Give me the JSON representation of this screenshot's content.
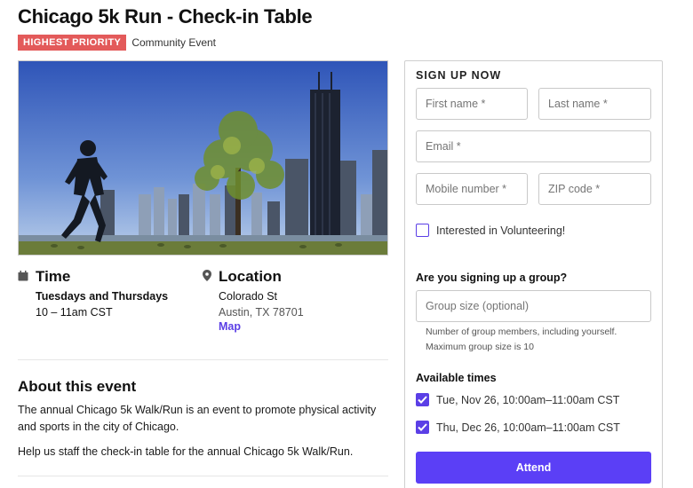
{
  "event": {
    "title": "Chicago 5k Run - Check-in Table",
    "priority_badge": "HIGHEST PRIORITY",
    "event_type": "Community Event"
  },
  "time": {
    "heading": "Time",
    "days": "Tuesdays and Thursdays",
    "hours": "10 – 11am CST"
  },
  "location": {
    "heading": "Location",
    "street": "Colorado St",
    "city": "Austin, TX 78701",
    "map_link": "Map"
  },
  "about": {
    "heading": "About this event",
    "paragraph1": "The annual Chicago 5k Walk/Run is an event to promote physical activity and sports in the city of Chicago.",
    "paragraph2": "Help us staff the check-in table for the annual Chicago 5k Walk/Run."
  },
  "signup": {
    "heading": "SIGN UP NOW",
    "first_name_placeholder": "First name *",
    "last_name_placeholder": "Last name *",
    "email_placeholder": "Email *",
    "mobile_placeholder": "Mobile number *",
    "zip_placeholder": "ZIP code *",
    "volunteer_label": "Interested in Volunteering!",
    "volunteer_checked": false,
    "group_question": "Are you signing up a group?",
    "group_size_placeholder": "Group size (optional)",
    "group_help_1": "Number of group members, including yourself.",
    "group_help_2": "Maximum group size is 10",
    "times_heading": "Available times",
    "times": [
      {
        "label": "Tue, Nov 26, 10:00am–11:00am CST",
        "checked": true
      },
      {
        "label": "Thu, Dec 26, 10:00am–11:00am CST",
        "checked": true
      }
    ],
    "attend_label": "Attend"
  },
  "colors": {
    "accent": "#5b3ff6",
    "priority": "#e35a5a"
  },
  "icons": {
    "time": "calendar-icon",
    "location": "map-pin-icon"
  }
}
